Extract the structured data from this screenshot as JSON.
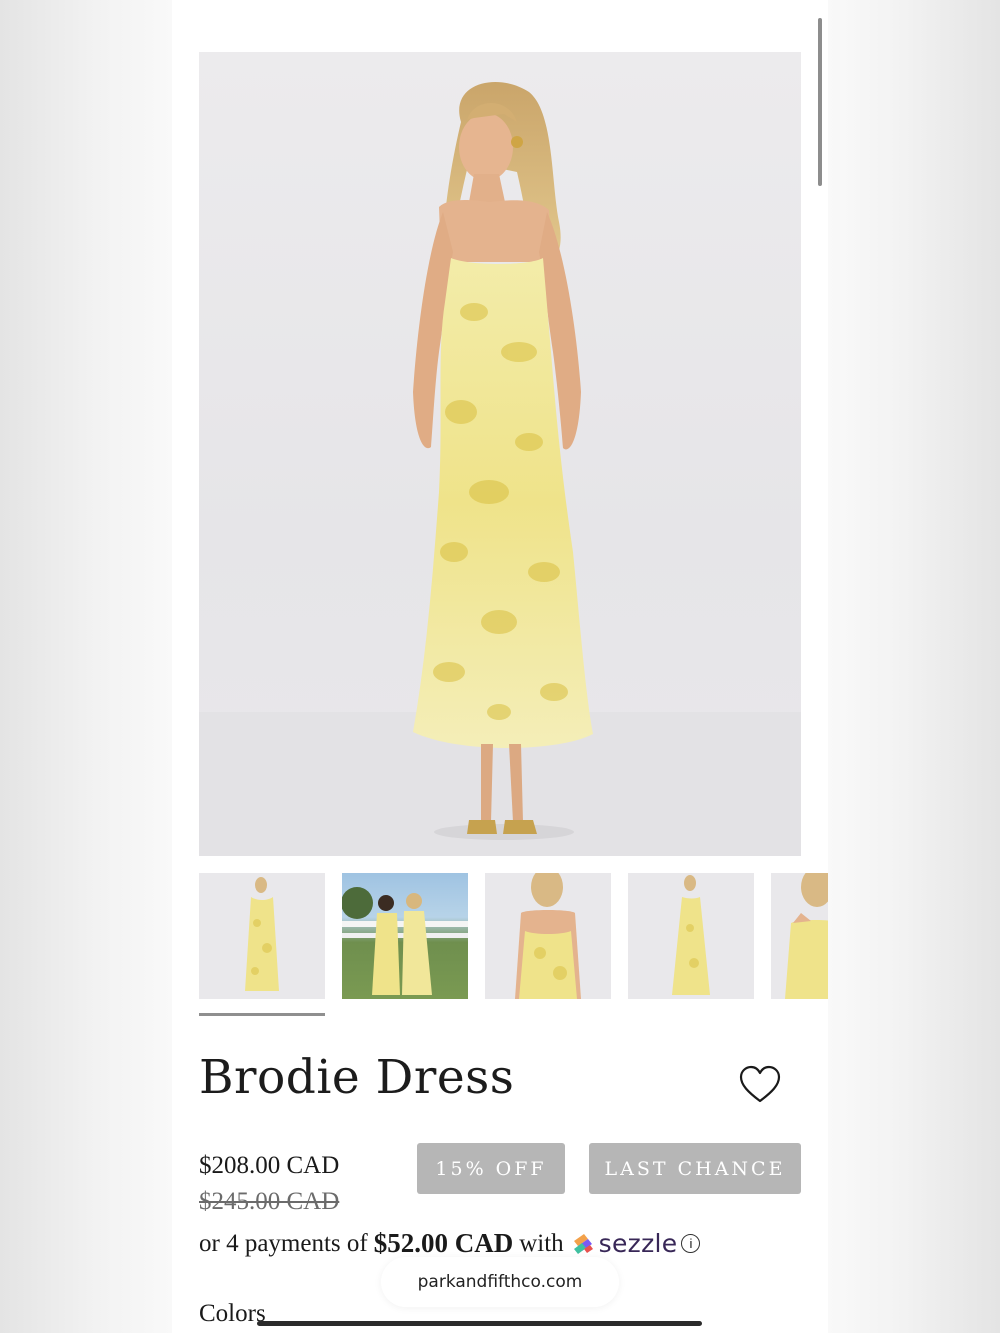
{
  "browser": {
    "url": "parkandfifthco.com"
  },
  "product": {
    "title": "Brodie Dress",
    "price": "$208.00 CAD",
    "original_price": "$245.00 CAD",
    "badges": [
      "15% OFF",
      "LAST CHANCE"
    ],
    "installments": {
      "prefix": "or 4 payments of",
      "amount": "$52.00 CAD",
      "suffix": "with",
      "provider": "sezzle"
    },
    "colors_label": "Colors"
  },
  "icons": {
    "wishlist": "heart-icon",
    "info": "info-icon",
    "provider_logo": "sezzle-logo"
  },
  "gallery": {
    "thumbnail_count": 5,
    "active_index": 0
  },
  "theme": {
    "badge_bg": "#b6b6b6",
    "dress_color": "#efe58f",
    "sezzle_purple": "#382757"
  }
}
